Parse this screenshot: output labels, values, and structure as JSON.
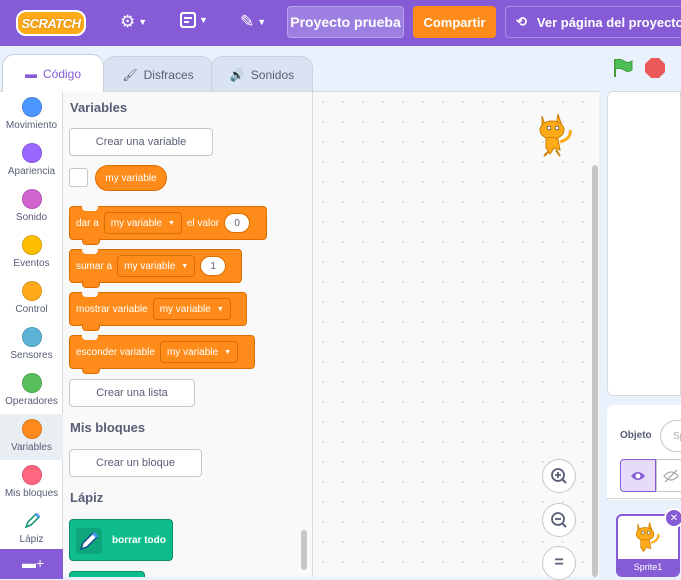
{
  "menubar": {
    "logo_text": "SCRATCH",
    "project_title": "Proyecto prueba",
    "share_label": "Compartir",
    "project_page_label": "Ver página del proyecto"
  },
  "tabs": [
    {
      "label": "Código",
      "icon": "code-icon"
    },
    {
      "label": "Disfraces",
      "icon": "brush-icon"
    },
    {
      "label": "Sonidos",
      "icon": "speaker-icon"
    }
  ],
  "categories": [
    {
      "label": "Movimiento",
      "color": "#4c97ff"
    },
    {
      "label": "Apariencia",
      "color": "#9966ff"
    },
    {
      "label": "Sonido",
      "color": "#cf63cf"
    },
    {
      "label": "Eventos",
      "color": "#ffbf00"
    },
    {
      "label": "Control",
      "color": "#ffab19"
    },
    {
      "label": "Sensores",
      "color": "#5cb1d6"
    },
    {
      "label": "Operadores",
      "color": "#59c059"
    },
    {
      "label": "Variables",
      "color": "#ff8c1a"
    },
    {
      "label": "Mis bloques",
      "color": "#ff6680"
    },
    {
      "label": "Lápiz",
      "icon": "pen-icon"
    }
  ],
  "palette": {
    "variables_title": "Variables",
    "create_variable": "Crear una variable",
    "variable_reporter": "my variable",
    "set_block": {
      "text": "dar a",
      "var": "my variable",
      "text2": "el valor",
      "value": "0"
    },
    "change_block": {
      "text": "sumar a",
      "var": "my variable",
      "value": "1"
    },
    "show_block": {
      "text": "mostrar variable",
      "var": "my variable"
    },
    "hide_block": {
      "text": "esconder variable",
      "var": "my variable"
    },
    "create_list": "Crear una lista",
    "my_blocks_title": "Mis bloques",
    "create_block": "Crear un bloque",
    "pen_title": "Lápiz",
    "pen_clear": "borrar todo"
  },
  "target_pane": {
    "object_label": "Objeto",
    "object_name_partial": "Sp",
    "sprite_name": "Sprite1"
  },
  "colors": {
    "accent": "#855cd6",
    "variables": "#ff8c1a",
    "pen": "#0fbd8c"
  }
}
